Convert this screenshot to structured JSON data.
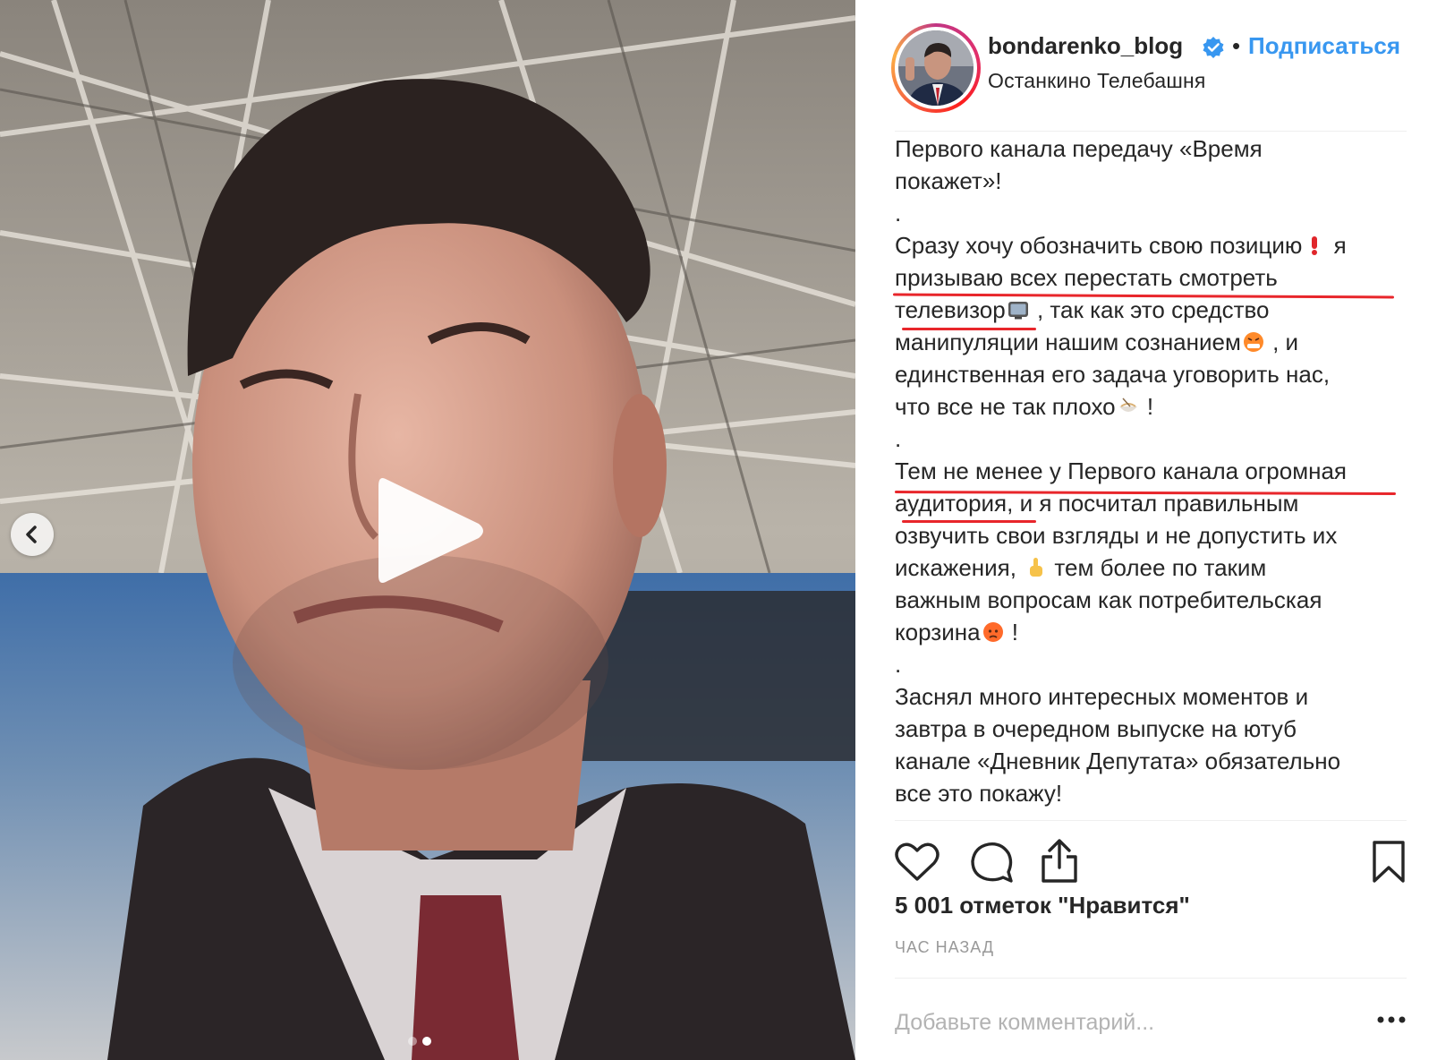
{
  "post": {
    "username": "bondarenko_blog",
    "follow_label": "Подписаться",
    "separator": "•",
    "location": "Останкино Телебашня"
  },
  "caption": {
    "lines": [
      "Первого канала передачу «Время",
      "покажет»!",
      ".",
      "Сразу хочу обозначить свою позицию",
      " я",
      "призываю всех перестать смотреть",
      "телевизор",
      " , так как это средство",
      "манипуляции нашим сознанием",
      " , и",
      "единственная его задача уговорить нас,",
      "что все не так плохо",
      "  !",
      ".",
      "Тем не менее у Первого канала огромная",
      "аудитория",
      ", и я посчитал правильным",
      "озвучить свои взгляды и не допустить их",
      "искажения,",
      " тем более по таким",
      "важным вопросам как потребительская",
      "корзина",
      " !",
      ".",
      "Заснял много интересных моментов и",
      "завтра в очередном выпуске на ютуб",
      "канале «Дневник Депутата» обязательно",
      "все это покажу!"
    ]
  },
  "likes": "5 001 отметок \"Нравится\"",
  "timestamp": "ЧАС НАЗАД",
  "comment_placeholder": "Добавьте комментарий...",
  "more_label": "•••",
  "colors": {
    "link_blue": "#3897f0",
    "annotation_red": "#e8262b",
    "text": "#262626",
    "muted": "#999999"
  },
  "icons": {
    "like": "heart-icon",
    "comment": "comment-bubble-icon",
    "share": "share-upload-icon",
    "save": "bookmark-icon",
    "play": "play-icon",
    "prev": "chevron-left-icon",
    "verified": "verified-badge-icon"
  },
  "carousel": {
    "count": 2,
    "active": 2
  }
}
